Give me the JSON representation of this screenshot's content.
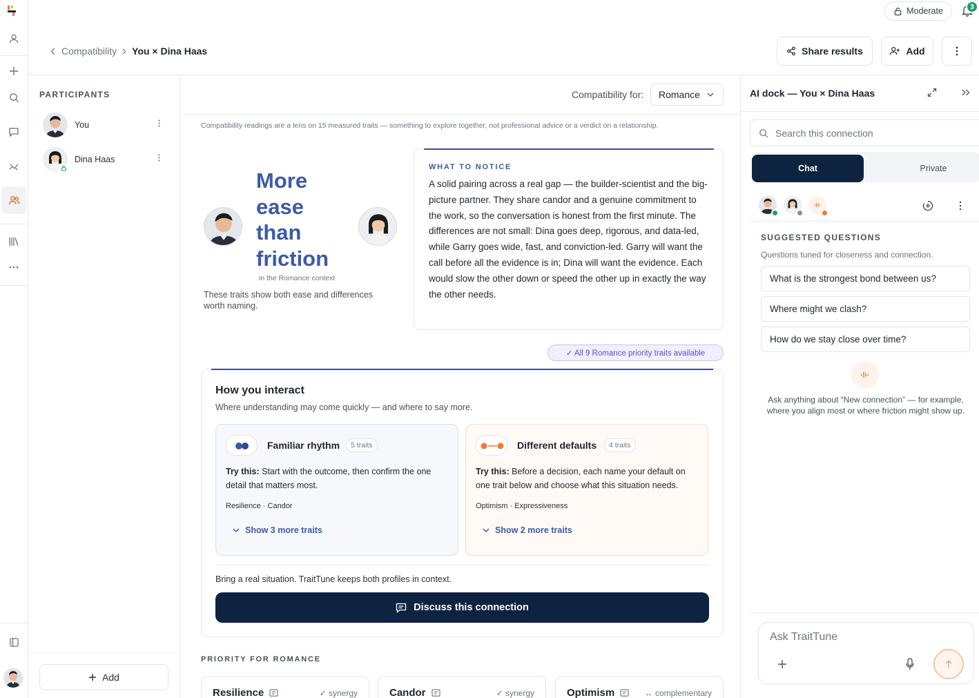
{
  "app": {
    "moderate_label": "Moderate",
    "notification_count": "3"
  },
  "breadcrumb": {
    "parent": "Compatibility",
    "current": "You × Dina Haas"
  },
  "header": {
    "share_label": "Share results",
    "add_label": "Add",
    "more_icon": "more-vertical-icon"
  },
  "participants": {
    "title": "PARTICIPANTS",
    "items": [
      {
        "name": "You"
      },
      {
        "name": "Dina Haas"
      }
    ],
    "add_label": "Add"
  },
  "main": {
    "compat_for_label": "Compatibility for:",
    "compat_for_value": "Romance",
    "disclaimer": "Compatibility readings are a lens on 15 measured traits — something to explore together, not professional advice or a verdict on a relationship.",
    "headline": "More ease than friction",
    "context": "in the Romance context",
    "context_desc": "These traits show both ease and differences worth naming.",
    "notice": {
      "label": "WHAT TO NOTICE",
      "text": "A solid pairing across a real gap — the builder-scientist and the big-picture partner. They share candor and a genuine commitment to the work, so the conversation is honest from the first minute. The differences are not small: Dina goes deep, rigorous, and data-led, while Garry goes wide, fast, and conviction-led. Garry will want the call before all the evidence is in; Dina will want the evidence. Each would slow the other down or speed the other up in exactly the way the other needs."
    },
    "priority_badge": "✓  All 9 Romance priority traits available",
    "interact": {
      "title": "How you interact",
      "subtitle": "Where understanding may come quickly — and where to say more.",
      "familiar": {
        "title": "Familiar rhythm",
        "count": "5 traits",
        "try_label": "Try this:",
        "try_text": "Start with the outcome, then confirm the one detail that matters most.",
        "traits": "Resilience · Candor",
        "show_more": "Show 3 more traits"
      },
      "different": {
        "title": "Different defaults",
        "count": "4 traits",
        "try_label": "Try this:",
        "try_text": "Before a decision, each name your default on one trait below and choose what this situation needs.",
        "traits": "Optimism · Expressiveness",
        "show_more": "Show 2 more traits"
      },
      "bring": "Bring a real situation. TraitTune keeps both profiles in context.",
      "discuss_label": "Discuss this connection"
    },
    "priority": {
      "title": "PRIORITY FOR ROMANCE",
      "cards": [
        {
          "name": "Resilience",
          "tag": "✓ synergy"
        },
        {
          "name": "Candor",
          "tag": "✓ synergy"
        },
        {
          "name": "Optimism",
          "tag": "↔ complementary"
        }
      ]
    }
  },
  "dock": {
    "title": "AI dock — You × Dina Haas",
    "search_placeholder": "Search this connection",
    "tab_chat": "Chat",
    "tab_private": "Private",
    "suggested_title": "SUGGESTED QUESTIONS",
    "suggested_sub": "Questions tuned for closeness and connection.",
    "questions": [
      "What is the strongest bond between us?",
      "Where might we clash?",
      "How do we stay close over time?"
    ],
    "hint": "Ask anything about “New connection” — for example, where you align most or where friction might show up.",
    "composer_placeholder": "Ask TraitTune"
  },
  "colors": {
    "accent": "#3c5aa6",
    "navy": "#0d2340",
    "orange": "#f07a2c",
    "green": "#1e9e6a"
  }
}
